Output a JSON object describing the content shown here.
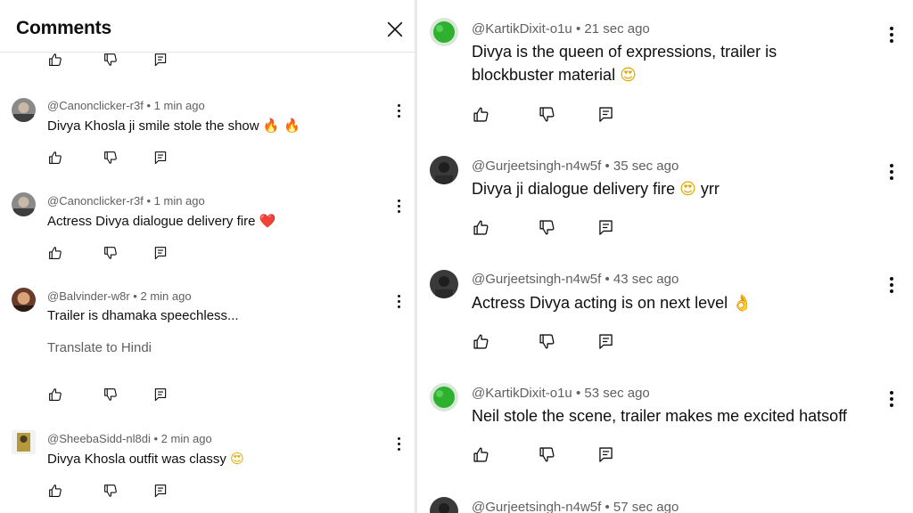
{
  "header": {
    "title": "Comments"
  },
  "labels": {
    "separator": "•",
    "translate": "Translate to Hindi"
  },
  "left_comments": [
    {
      "handle": "@Canonclicker-r3f",
      "time": "1 min ago",
      "text": "Divya Khosla ji smile stole the show",
      "emoji": "🔥 🔥",
      "avatar": "canon"
    },
    {
      "handle": "@Canonclicker-r3f",
      "time": "1 min ago",
      "text": "Actress Divya dialogue delivery fire",
      "emoji": "❤️",
      "avatar": "canon"
    },
    {
      "handle": "@Balvinder-w8r",
      "time": "2 min ago",
      "text": "Trailer is dhamaka speechless...",
      "emoji": "",
      "avatar": "balvinder",
      "translate": true
    },
    {
      "handle": "@SheebaSidd-nl8di",
      "time": "2 min ago",
      "text": "Divya Khosla outfit was classy",
      "emoji": "😍",
      "avatar": "sheeba"
    }
  ],
  "right_comments": [
    {
      "handle": "@KartikDixit-o1u",
      "time": "21 sec ago",
      "text": "Divya is the queen of expressions, trailer is",
      "text2": "blockbuster material",
      "emoji": "😍",
      "avatar": "kartik"
    },
    {
      "handle": "@Gurjeetsingh-n4w5f",
      "time": "35 sec ago",
      "text": "Divya ji dialogue delivery fire",
      "emoji": "😍",
      "suffix": "yrr",
      "avatar": "gurjeet"
    },
    {
      "handle": "@Gurjeetsingh-n4w5f",
      "time": "43 sec ago",
      "text": "Actress Divya acting is on next level",
      "emoji": "👌",
      "avatar": "gurjeet"
    },
    {
      "handle": "@KartikDixit-o1u",
      "time": "53 sec ago",
      "text": "Neil stole the scene, trailer makes me excited hatsoff",
      "emoji": "",
      "avatar": "kartik"
    },
    {
      "handle": "@Gurjeetsingh-n4w5f",
      "time": "57 sec ago",
      "text": "",
      "emoji": "",
      "avatar": "gurjeet"
    }
  ],
  "icons": {
    "close": "close-icon",
    "more": "more-vert-icon",
    "like": "thumb-up-icon",
    "dislike": "thumb-down-icon",
    "reply": "reply-icon"
  },
  "colors": {
    "text": "#0f0f0f",
    "meta": "#606060",
    "divider": "#e5e5e5",
    "background": "#ffffff",
    "kartik_avatar": "#2fb02f"
  }
}
